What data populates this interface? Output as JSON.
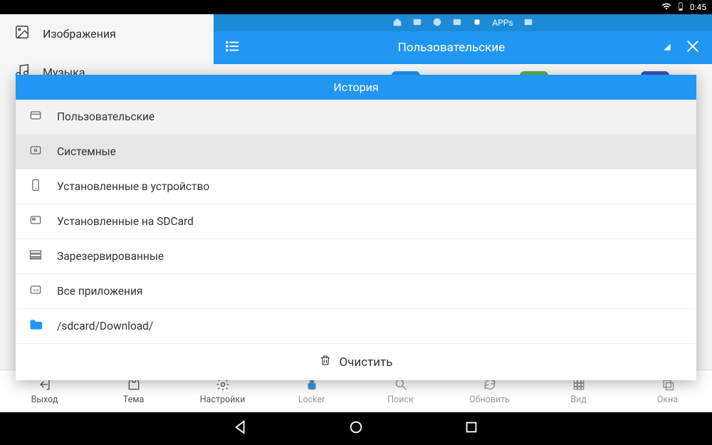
{
  "status_bar": {
    "time": "0:45"
  },
  "sidebar": {
    "items": [
      {
        "label": "Изображения"
      },
      {
        "label": "Музыка"
      }
    ]
  },
  "crumb": {
    "apps_label": "APPs"
  },
  "main_header": {
    "title": "Пользовательские"
  },
  "modal": {
    "title": "История",
    "items": [
      {
        "label": "Пользовательские"
      },
      {
        "label": "Системные"
      },
      {
        "label": "Установленные в устройство"
      },
      {
        "label": "Установленные на SDCard"
      },
      {
        "label": "Зарезервированные"
      },
      {
        "label": "Все приложения"
      },
      {
        "label": "/sdcard/Download/"
      }
    ],
    "clear_label": "Очистить"
  },
  "toolbar": {
    "items": [
      {
        "label": "Выход"
      },
      {
        "label": "Тема"
      },
      {
        "label": "Настройки"
      },
      {
        "label": "Locker"
      },
      {
        "label": "Поиск"
      },
      {
        "label": "Обновить"
      },
      {
        "label": "Вид"
      },
      {
        "label": "Окна"
      }
    ]
  }
}
